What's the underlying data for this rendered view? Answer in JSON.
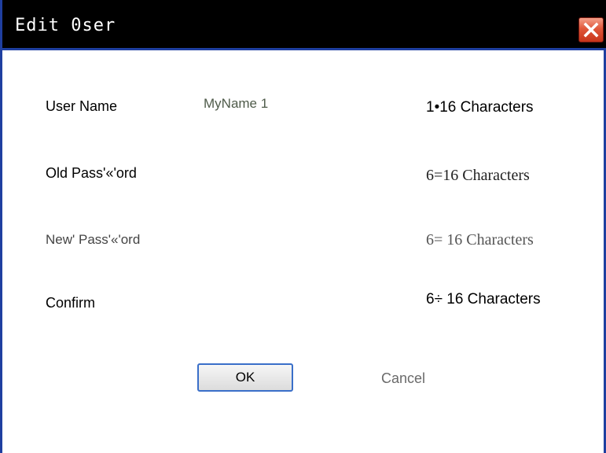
{
  "window": {
    "title": "Edit  0ser",
    "close_icon": "close-icon"
  },
  "form": {
    "user_name": {
      "label": "User Name",
      "value": "MyName 1",
      "hint": "1•16 Characters"
    },
    "old_password": {
      "label": "Old  Pass'«'ord",
      "hint": "6=16 Characters"
    },
    "new_password": {
      "label": "New'  Pass'«'ord",
      "hint": "6=  16 Characters"
    },
    "confirm": {
      "label": "Confirm",
      "hint": "6÷ 16 Characters"
    }
  },
  "buttons": {
    "ok_label": "OK",
    "cancel_label": "Cancel"
  },
  "colors": {
    "titlebar_bg": "#000000",
    "frame_border": "#1f3fa0",
    "close_button": "#e0573a",
    "value_text": "#4f5b4a"
  }
}
